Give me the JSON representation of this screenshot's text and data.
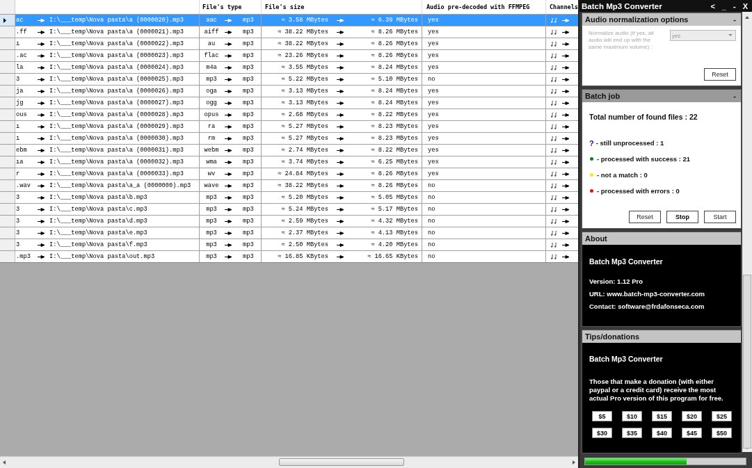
{
  "table": {
    "columns": [
      "File's type",
      "File's size",
      "Audio pre-decoded with FFMPEG",
      "Channels"
    ],
    "rows": [
      {
        "source": "ac",
        "path": "I:\\___temp\\Nova pasta\\a (0000020).mp3",
        "from_type": "aac",
        "to_type": "mp3",
        "size_in": "≈ 3.58 MBytes",
        "size_out": "≈ 6.39 MBytes",
        "predecoded": "yes",
        "selected": true
      },
      {
        "source": ".ff",
        "path": "I:\\___temp\\Nova pasta\\a (0000021).mp3",
        "from_type": "aiff",
        "to_type": "mp3",
        "size_in": "≈ 38.22 MBytes",
        "size_out": "≈ 8.26 MBytes",
        "predecoded": "yes",
        "selected": false
      },
      {
        "source": "ı",
        "path": "I:\\___temp\\Nova pasta\\a (0000022).mp3",
        "from_type": "au",
        "to_type": "mp3",
        "size_in": "≈ 38.22 MBytes",
        "size_out": "≈ 8.26 MBytes",
        "predecoded": "yes",
        "selected": false
      },
      {
        "source": ".ac",
        "path": "I:\\___temp\\Nova pasta\\a (0000023).mp3",
        "from_type": "flac",
        "to_type": "mp3",
        "size_in": "≈ 23.26 MBytes",
        "size_out": "≈ 8.26 MBytes",
        "predecoded": "yes",
        "selected": false
      },
      {
        "source": "la",
        "path": "I:\\___temp\\Nova pasta\\a (0000024).mp3",
        "from_type": "m4a",
        "to_type": "mp3",
        "size_in": "≈ 3.55 MBytes",
        "size_out": "≈ 8.24 MBytes",
        "predecoded": "yes",
        "selected": false
      },
      {
        "source": "3",
        "path": "I:\\___temp\\Nova pasta\\a (0000025).mp3",
        "from_type": "mp3",
        "to_type": "mp3",
        "size_in": "≈ 5.22 MBytes",
        "size_out": "≈ 5.10 MBytes",
        "predecoded": "no",
        "selected": false
      },
      {
        "source": "ja",
        "path": "I:\\___temp\\Nova pasta\\a (0000026).mp3",
        "from_type": "oga",
        "to_type": "mp3",
        "size_in": "≈ 3.13 MBytes",
        "size_out": "≈ 8.24 MBytes",
        "predecoded": "yes",
        "selected": false
      },
      {
        "source": "jg",
        "path": "I:\\___temp\\Nova pasta\\a (0000027).mp3",
        "from_type": "ogg",
        "to_type": "mp3",
        "size_in": "≈ 3.13 MBytes",
        "size_out": "≈ 8.24 MBytes",
        "predecoded": "yes",
        "selected": false
      },
      {
        "source": "ous",
        "path": "I:\\___temp\\Nova pasta\\a (0000028).mp3",
        "from_type": "opus",
        "to_type": "mp3",
        "size_in": "≈ 2.68 MBytes",
        "size_out": "≈ 8.22 MBytes",
        "predecoded": "yes",
        "selected": false
      },
      {
        "source": "ı",
        "path": "I:\\___temp\\Nova pasta\\a (0000029).mp3",
        "from_type": "ra",
        "to_type": "mp3",
        "size_in": "≈ 5.27 MBytes",
        "size_out": "≈ 8.23 MBytes",
        "predecoded": "yes",
        "selected": false
      },
      {
        "source": "ı",
        "path": "I:\\___temp\\Nova pasta\\a (0000030).mp3",
        "from_type": "rm",
        "to_type": "mp3",
        "size_in": "≈ 5.27 MBytes",
        "size_out": "≈ 8.23 MBytes",
        "predecoded": "yes",
        "selected": false
      },
      {
        "source": "ebm",
        "path": "I:\\___temp\\Nova pasta\\a (0000031).mp3",
        "from_type": "webm",
        "to_type": "mp3",
        "size_in": "≈ 2.74 MBytes",
        "size_out": "≈ 8.22 MBytes",
        "predecoded": "yes",
        "selected": false
      },
      {
        "source": "ıa",
        "path": "I:\\___temp\\Nova pasta\\a (0000032).mp3",
        "from_type": "wma",
        "to_type": "mp3",
        "size_in": "≈ 3.74 MBytes",
        "size_out": "≈ 6.25 MBytes",
        "predecoded": "yes",
        "selected": false
      },
      {
        "source": "r",
        "path": "I:\\___temp\\Nova pasta\\a (0000033).mp3",
        "from_type": "wv",
        "to_type": "mp3",
        "size_in": "≈ 24.84 MBytes",
        "size_out": "≈ 8.26 MBytes",
        "predecoded": "yes",
        "selected": false
      },
      {
        "source": ".wav",
        "path": "I:\\___temp\\Nova pasta\\a_a (0000000).mp3",
        "from_type": "wave",
        "to_type": "mp3",
        "size_in": "≈ 38.22 MBytes",
        "size_out": "≈ 8.26 MBytes",
        "predecoded": "no",
        "selected": false
      },
      {
        "source": "3",
        "path": "I:\\___temp\\Nova pasta\\b.mp3",
        "from_type": "mp3",
        "to_type": "mp3",
        "size_in": "≈ 5.20 MBytes",
        "size_out": "≈ 5.05 MBytes",
        "predecoded": "no",
        "selected": false
      },
      {
        "source": "3",
        "path": "I:\\___temp\\Nova pasta\\c.mp3",
        "from_type": "mp3",
        "to_type": "mp3",
        "size_in": "≈ 5.24 MBytes",
        "size_out": "≈ 5.17 MBytes",
        "predecoded": "no",
        "selected": false
      },
      {
        "source": "3",
        "path": "I:\\___temp\\Nova pasta\\d.mp3",
        "from_type": "mp3",
        "to_type": "mp3",
        "size_in": "≈ 2.59 MBytes",
        "size_out": "≈ 4.32 MBytes",
        "predecoded": "no",
        "selected": false
      },
      {
        "source": "3",
        "path": "I:\\___temp\\Nova pasta\\e.mp3",
        "from_type": "mp3",
        "to_type": "mp3",
        "size_in": "≈ 2.37 MBytes",
        "size_out": "≈ 4.13 MBytes",
        "predecoded": "no",
        "selected": false
      },
      {
        "source": "3",
        "path": "I:\\___temp\\Nova pasta\\f.mp3",
        "from_type": "mp3",
        "to_type": "mp3",
        "size_in": "≈ 2.50 MBytes",
        "size_out": "≈ 4.20 MBytes",
        "predecoded": "no",
        "selected": false
      },
      {
        "source": ".mp3",
        "path": "I:\\___temp\\Nova pasta\\out.mp3",
        "from_type": "mp3",
        "to_type": "mp3",
        "size_in": "≈ 16.85 KBytes",
        "size_out": "≈ 16.65 KBytes",
        "predecoded": "no",
        "selected": false
      }
    ]
  },
  "window": {
    "title": "Batch Mp3 Converter",
    "controls": [
      "<",
      "_",
      "-",
      "X"
    ]
  },
  "normalization": {
    "title": "Audio normalization options",
    "collapse": "-",
    "label": "Normalize audio (if yes, all audio will end up with the same maximum volume) :",
    "select": {
      "value": "yes",
      "disabled": true
    },
    "reset": "Reset"
  },
  "batch_job": {
    "title": "Batch job",
    "collapse": "-",
    "total": "Total number of found files : 22",
    "legend": [
      {
        "kind": "mark",
        "symbol": "?",
        "color": "#1010b0",
        "text": "- still unprocessed : 1"
      },
      {
        "kind": "dot",
        "color": "#1a7a1a",
        "text": "- processed with success : 21"
      },
      {
        "kind": "dot",
        "color": "#f0f000",
        "text": "- not a match : 0"
      },
      {
        "kind": "dot",
        "color": "#e01010",
        "text": "- processed with errors : 0"
      }
    ],
    "buttons": [
      {
        "label": "Reset",
        "default": false
      },
      {
        "label": "Stop",
        "default": true
      },
      {
        "label": "Start",
        "default": false
      }
    ]
  },
  "about": {
    "title": "About",
    "name": "Batch Mp3 Converter",
    "version": "Version: 1.12 Pro",
    "url": "URL: www.batch-mp3-converter.com",
    "contact": "Contact: software@frdafonseca.com"
  },
  "tips": {
    "title": "Tips/donations",
    "name": "Batch Mp3 Converter",
    "text": "Those that make a donation (with either paypal or a credit card) receive the most actual Pro version of this program for free.",
    "amounts": [
      "$5",
      "$10",
      "$15",
      "$20",
      "$25",
      "$30",
      "$35",
      "$40",
      "$45",
      "$50"
    ]
  },
  "progress": {
    "level": 0.63
  }
}
